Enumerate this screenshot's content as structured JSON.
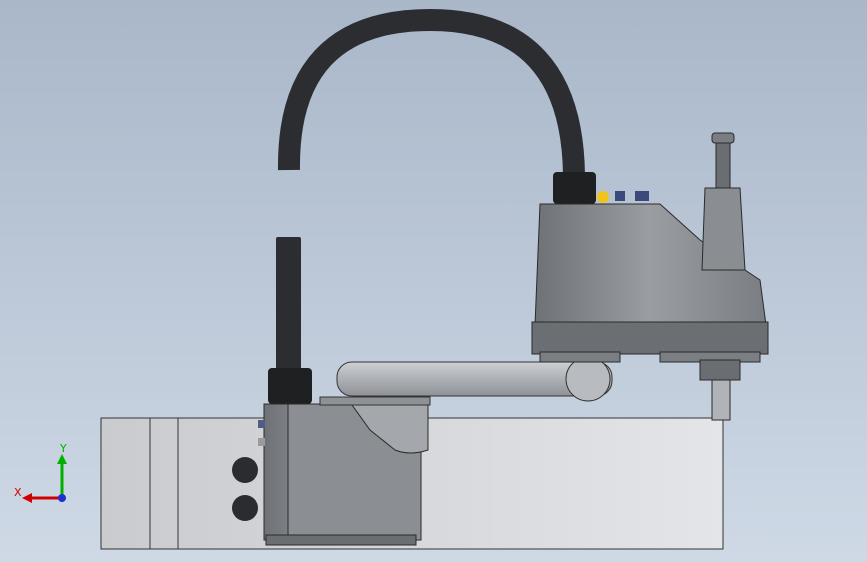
{
  "viewport": {
    "background_top": "#a9b7c9",
    "background_bottom": "#cfd9e6"
  },
  "model": {
    "name_icon": "scara-robot-icon",
    "part_color": "#8f9297",
    "dark_part_color": "#5f6267",
    "cable_color": "#2c2d30",
    "base_box_color": "#dcdde0",
    "status_dot_color": "#f0c419"
  },
  "triad": {
    "x_label": "X",
    "y_label": "Y",
    "x_color": "#d00000",
    "y_color": "#00b000",
    "z_color": "#1f2fd0"
  }
}
